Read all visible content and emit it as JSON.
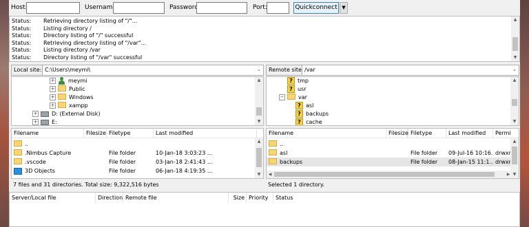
{
  "quickconnect": {
    "host_label": "Host:",
    "username_label": "Username:",
    "password_label": "Password:",
    "port_label": "Port:",
    "host_value": "",
    "username_value": "",
    "password_value": "",
    "port_value": "",
    "button_label": "Quickconnect",
    "dropdown_glyph": "▼"
  },
  "log": [
    {
      "key": "Status:",
      "text": "Retrieving directory listing of \"/\"..."
    },
    {
      "key": "Status:",
      "text": "Listing directory /"
    },
    {
      "key": "Status:",
      "text": "Directory listing of \"/\" successful"
    },
    {
      "key": "Status:",
      "text": "Retrieving directory listing of \"/var\"..."
    },
    {
      "key": "Status:",
      "text": "Listing directory /var"
    },
    {
      "key": "Status:",
      "text": "Directory listing of \"/var\" successful"
    }
  ],
  "local": {
    "site_label": "Local site:",
    "path": "C:\\Users\\meymi\\",
    "tree": [
      {
        "label": "meymi",
        "icon": "user-icon",
        "expander": "+"
      },
      {
        "label": "Public",
        "icon": "folder-icon",
        "expander": "+"
      },
      {
        "label": "Windows",
        "icon": "folder-icon",
        "expander": "+"
      },
      {
        "label": "xampp",
        "icon": "folder-icon",
        "expander": "+"
      },
      {
        "label": "D: (External Disk)",
        "icon": "drive-icon",
        "expander": "+"
      },
      {
        "label": "E:",
        "icon": "drive-icon",
        "expander": "+"
      }
    ],
    "columns": [
      "Filename",
      "Filesize",
      "Filetype",
      "Last modified"
    ],
    "files": [
      {
        "name": "..",
        "size": "",
        "type": "",
        "modified": ""
      },
      {
        "name": ".Nimbus Capture",
        "size": "",
        "type": "File folder",
        "modified": "10-Jan-18 3:03:23 ..."
      },
      {
        "name": ".vscode",
        "size": "",
        "type": "File folder",
        "modified": "03-Jan-18 2:41:43 ..."
      },
      {
        "name": "3D Objects",
        "size": "",
        "type": "File folder",
        "modified": "06-Jan-18 4:19:35 ..."
      }
    ],
    "status": "7 files and 31 directories. Total size: 9,322,516 bytes"
  },
  "remote": {
    "site_label": "Remote site:",
    "path": "/var",
    "tree": [
      {
        "label": "tmp",
        "icon": "unknown-folder-icon",
        "expander": ""
      },
      {
        "label": "usr",
        "icon": "unknown-folder-icon",
        "expander": ""
      },
      {
        "label": "var",
        "icon": "folder-icon",
        "expander": "−"
      },
      {
        "label": "asl",
        "icon": "unknown-folder-icon",
        "expander": ""
      },
      {
        "label": "backups",
        "icon": "unknown-folder-icon",
        "expander": ""
      },
      {
        "label": "cache",
        "icon": "unknown-folder-icon",
        "expander": ""
      }
    ],
    "columns": [
      "Filename",
      "Filesize",
      "Filetype",
      "Last modified",
      "Permi"
    ],
    "files": [
      {
        "name": "..",
        "size": "",
        "type": "",
        "modified": "",
        "perm": ""
      },
      {
        "name": "asl",
        "size": "",
        "type": "File folder",
        "modified": "09-Jul-16 10:16...",
        "perm": "drwxr"
      },
      {
        "name": "backups",
        "size": "",
        "type": "File folder",
        "modified": "08-Jan-15 11:1...",
        "perm": "drwxr"
      }
    ],
    "status": "Selected 1 directory."
  },
  "queue": {
    "columns": [
      "Server/Local file",
      "Direction",
      "Remote file",
      "Size",
      "Priority",
      "Status"
    ]
  },
  "colors": {
    "accent_button_bg": "#e5f1fb",
    "accent_button_border": "#3c7fb1",
    "folder": "#f7d474",
    "unknown_folder": "#f3d046"
  }
}
